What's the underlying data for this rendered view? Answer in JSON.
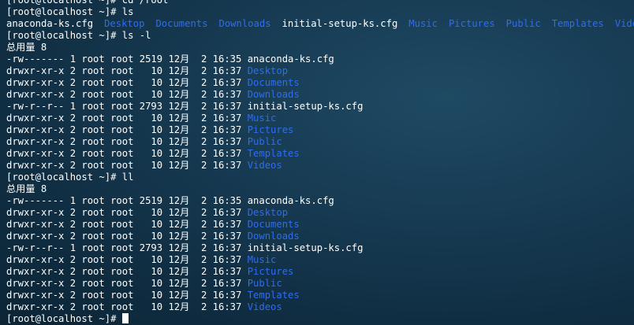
{
  "terminal": {
    "lines": [
      {
        "type": "cmd",
        "prompt": "[root@localhost ~]# ",
        "command": "cd /root"
      },
      {
        "type": "cmd",
        "prompt": "[root@localhost ~]# ",
        "command": "ls"
      },
      {
        "type": "ls",
        "items": [
          {
            "name": "anaconda-ks.cfg",
            "kind": "file"
          },
          {
            "name": "Desktop",
            "kind": "dir"
          },
          {
            "name": "Documents",
            "kind": "dir"
          },
          {
            "name": "Downloads",
            "kind": "dir"
          },
          {
            "name": "initial-setup-ks.cfg",
            "kind": "file"
          },
          {
            "name": "Music",
            "kind": "dir"
          },
          {
            "name": "Pictures",
            "kind": "dir"
          },
          {
            "name": "Public",
            "kind": "dir"
          },
          {
            "name": "Templates",
            "kind": "dir"
          },
          {
            "name": "Videos",
            "kind": "dir"
          }
        ]
      },
      {
        "type": "cmd",
        "prompt": "[root@localhost ~]# ",
        "command": "ls -l"
      },
      {
        "type": "text",
        "text": "总用量 8"
      },
      {
        "type": "entry",
        "meta": "-rw------- 1 root root 2519 12月  2 16:35 ",
        "name": "anaconda-ks.cfg",
        "kind": "file"
      },
      {
        "type": "entry",
        "meta": "drwxr-xr-x 2 root root   10 12月  2 16:37 ",
        "name": "Desktop",
        "kind": "dir"
      },
      {
        "type": "entry",
        "meta": "drwxr-xr-x 2 root root   10 12月  2 16:37 ",
        "name": "Documents",
        "kind": "dir"
      },
      {
        "type": "entry",
        "meta": "drwxr-xr-x 2 root root   10 12月  2 16:37 ",
        "name": "Downloads",
        "kind": "dir"
      },
      {
        "type": "entry",
        "meta": "-rw-r--r-- 1 root root 2793 12月  2 16:37 ",
        "name": "initial-setup-ks.cfg",
        "kind": "file"
      },
      {
        "type": "entry",
        "meta": "drwxr-xr-x 2 root root   10 12月  2 16:37 ",
        "name": "Music",
        "kind": "dir"
      },
      {
        "type": "entry",
        "meta": "drwxr-xr-x 2 root root   10 12月  2 16:37 ",
        "name": "Pictures",
        "kind": "dir"
      },
      {
        "type": "entry",
        "meta": "drwxr-xr-x 2 root root   10 12月  2 16:37 ",
        "name": "Public",
        "kind": "dir"
      },
      {
        "type": "entry",
        "meta": "drwxr-xr-x 2 root root   10 12月  2 16:37 ",
        "name": "Templates",
        "kind": "dir"
      },
      {
        "type": "entry",
        "meta": "drwxr-xr-x 2 root root   10 12月  2 16:37 ",
        "name": "Videos",
        "kind": "dir"
      },
      {
        "type": "cmd",
        "prompt": "[root@localhost ~]# ",
        "command": "ll"
      },
      {
        "type": "text",
        "text": "总用量 8"
      },
      {
        "type": "entry",
        "meta": "-rw------- 1 root root 2519 12月  2 16:35 ",
        "name": "anaconda-ks.cfg",
        "kind": "file"
      },
      {
        "type": "entry",
        "meta": "drwxr-xr-x 2 root root   10 12月  2 16:37 ",
        "name": "Desktop",
        "kind": "dir"
      },
      {
        "type": "entry",
        "meta": "drwxr-xr-x 2 root root   10 12月  2 16:37 ",
        "name": "Documents",
        "kind": "dir"
      },
      {
        "type": "entry",
        "meta": "drwxr-xr-x 2 root root   10 12月  2 16:37 ",
        "name": "Downloads",
        "kind": "dir"
      },
      {
        "type": "entry",
        "meta": "-rw-r--r-- 1 root root 2793 12月  2 16:37 ",
        "name": "initial-setup-ks.cfg",
        "kind": "file"
      },
      {
        "type": "entry",
        "meta": "drwxr-xr-x 2 root root   10 12月  2 16:37 ",
        "name": "Music",
        "kind": "dir"
      },
      {
        "type": "entry",
        "meta": "drwxr-xr-x 2 root root   10 12月  2 16:37 ",
        "name": "Pictures",
        "kind": "dir"
      },
      {
        "type": "entry",
        "meta": "drwxr-xr-x 2 root root   10 12月  2 16:37 ",
        "name": "Public",
        "kind": "dir"
      },
      {
        "type": "entry",
        "meta": "drwxr-xr-x 2 root root   10 12月  2 16:37 ",
        "name": "Templates",
        "kind": "dir"
      },
      {
        "type": "entry",
        "meta": "drwxr-xr-x 2 root root   10 12月  2 16:37 ",
        "name": "Videos",
        "kind": "dir"
      },
      {
        "type": "prompt",
        "prompt": "[root@localhost ~]# "
      }
    ],
    "colors": {
      "text": "#ffffff",
      "directory": "#2f6cf0",
      "background": "#163a52"
    }
  }
}
